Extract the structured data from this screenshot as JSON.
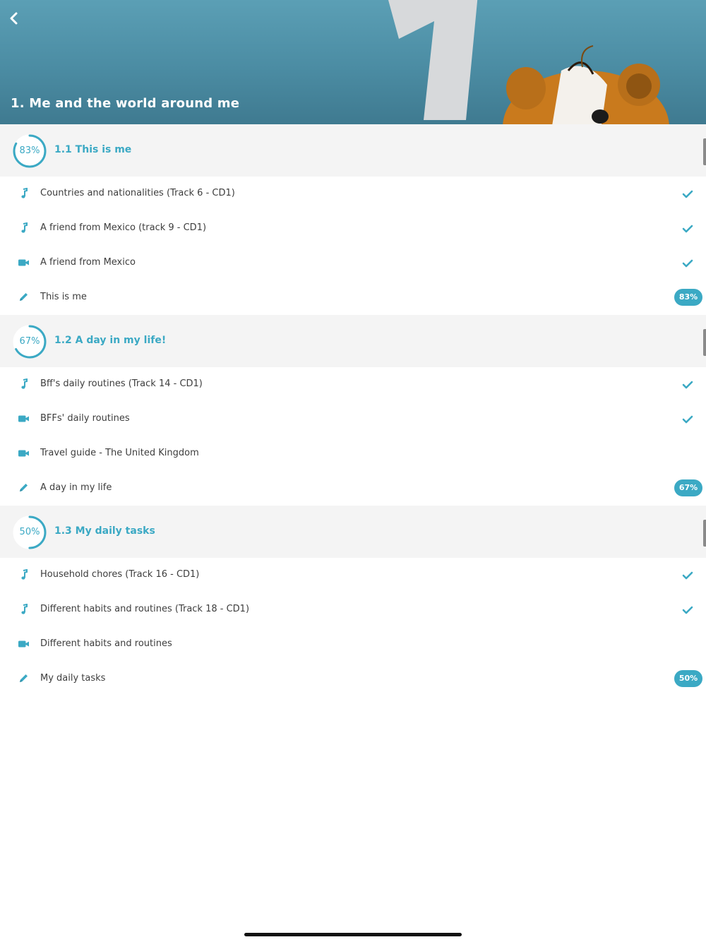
{
  "header": {
    "title": "1. Me and the world around me",
    "back_icon": "chevron-left-icon",
    "accent_color": "#3ba9c4"
  },
  "sections": [
    {
      "progress_label": "83%",
      "progress": 0.83,
      "title": "1.1 This is me",
      "items": [
        {
          "icon": "music-note-icon",
          "label": "Countries and nationalities (Track 6 - CD1)",
          "status": "check"
        },
        {
          "icon": "music-note-icon",
          "label": "A friend from Mexico (track 9 - CD1)",
          "status": "check"
        },
        {
          "icon": "video-camera-icon",
          "label": "A friend from Mexico",
          "status": "check"
        },
        {
          "icon": "pencil-icon",
          "label": "This is me",
          "status": "badge",
          "badge": "83%"
        }
      ]
    },
    {
      "progress_label": "67%",
      "progress": 0.67,
      "title": "1.2 A day in my life!",
      "items": [
        {
          "icon": "music-note-icon",
          "label": "Bff's daily routines (Track 14 - CD1)",
          "status": "check"
        },
        {
          "icon": "video-camera-icon",
          "label": "BFFs' daily routines",
          "status": "check"
        },
        {
          "icon": "video-camera-icon",
          "label": "Travel guide - The United Kingdom",
          "status": "none"
        },
        {
          "icon": "pencil-icon",
          "label": "A day in my life",
          "status": "badge",
          "badge": "67%"
        }
      ]
    },
    {
      "progress_label": "50%",
      "progress": 0.5,
      "title": "1.3 My daily tasks",
      "items": [
        {
          "icon": "music-note-icon",
          "label": "Household chores (Track 16 - CD1)",
          "status": "check"
        },
        {
          "icon": "music-note-icon",
          "label": "Different habits and routines (Track 18 - CD1)",
          "status": "check"
        },
        {
          "icon": "video-camera-icon",
          "label": "Different habits and routines",
          "status": "none"
        },
        {
          "icon": "pencil-icon",
          "label": "My daily tasks",
          "status": "badge",
          "badge": "50%"
        }
      ]
    }
  ]
}
